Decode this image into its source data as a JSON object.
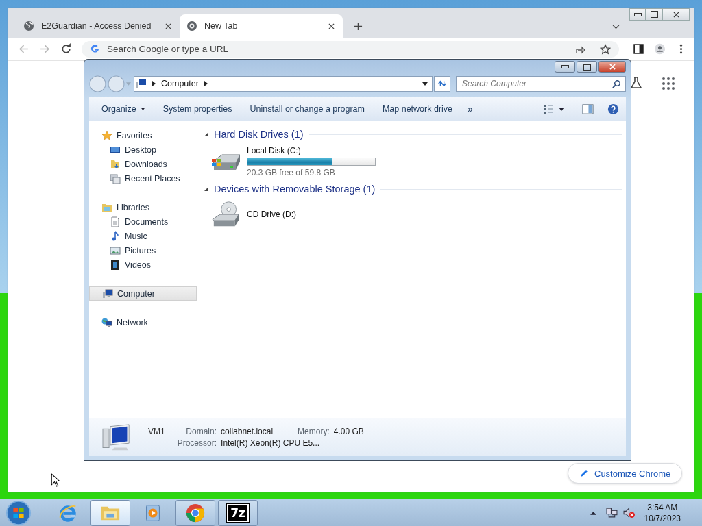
{
  "chrome": {
    "tabs": [
      {
        "title": "E2Guardian - Access Denied",
        "kind": "globe",
        "selected": false
      },
      {
        "title": "New Tab",
        "kind": "chrome",
        "selected": true
      }
    ],
    "omnibox": {
      "placeholder": "Search Google or type a URL"
    },
    "customize_button": "Customize Chrome"
  },
  "explorer": {
    "breadcrumb": [
      "Computer"
    ],
    "search": {
      "placeholder": "Search Computer"
    },
    "commands": [
      {
        "label": "Organize",
        "kind": "menu"
      },
      {
        "label": "System properties",
        "kind": "plain"
      },
      {
        "label": "Uninstall or change a program",
        "kind": "plain"
      },
      {
        "label": "Map network drive",
        "kind": "plain"
      }
    ],
    "overflow": "»",
    "sidebar": [
      {
        "label": "Favorites",
        "kind": "star",
        "selected": false,
        "children": [
          {
            "label": "Desktop",
            "kind": "desktop",
            "selected": false
          },
          {
            "label": "Downloads",
            "kind": "downloads",
            "selected": false
          },
          {
            "label": "Recent Places",
            "kind": "recent",
            "selected": false
          }
        ]
      },
      {
        "label": "Libraries",
        "kind": "libraries",
        "selected": false,
        "children": [
          {
            "label": "Documents",
            "kind": "documents",
            "selected": false
          },
          {
            "label": "Music",
            "kind": "music",
            "selected": false
          },
          {
            "label": "Pictures",
            "kind": "pictures",
            "selected": false
          },
          {
            "label": "Videos",
            "kind": "videos",
            "selected": false
          }
        ]
      },
      {
        "label": "Computer",
        "kind": "computer",
        "selected": true
      },
      {
        "label": "Network",
        "kind": "network",
        "selected": false
      }
    ],
    "groups": [
      {
        "title": "Hard Disk Drives (1)",
        "items": [
          {
            "name": "Local Disk (C:)",
            "kind": "disk",
            "level": 0.66,
            "free": "20.3 GB free of 59.8 GB"
          }
        ]
      },
      {
        "title": "Devices with Removable Storage (1)",
        "items": [
          {
            "name": "CD Drive (D:)",
            "kind": "cd"
          }
        ]
      }
    ],
    "details": {
      "name": "VM1",
      "fields": [
        {
          "label": "Domain:",
          "value": "collabnet.local"
        },
        {
          "label": "Memory:",
          "value": "4.00 GB"
        },
        {
          "label": "Processor:",
          "value": "Intel(R) Xeon(R) CPU E5..."
        }
      ]
    }
  },
  "taskbar": {
    "apps": [
      {
        "kind": "ie",
        "running": false,
        "selected": false
      },
      {
        "kind": "explorer",
        "running": true,
        "selected": true
      },
      {
        "kind": "media",
        "running": false,
        "selected": false
      },
      {
        "kind": "chrome",
        "running": true,
        "selected": false
      },
      {
        "kind": "archiver",
        "running": true,
        "selected": false,
        "text": "7z"
      }
    ],
    "clock": {
      "time": "3:54 AM",
      "date": "10/7/2023"
    }
  }
}
